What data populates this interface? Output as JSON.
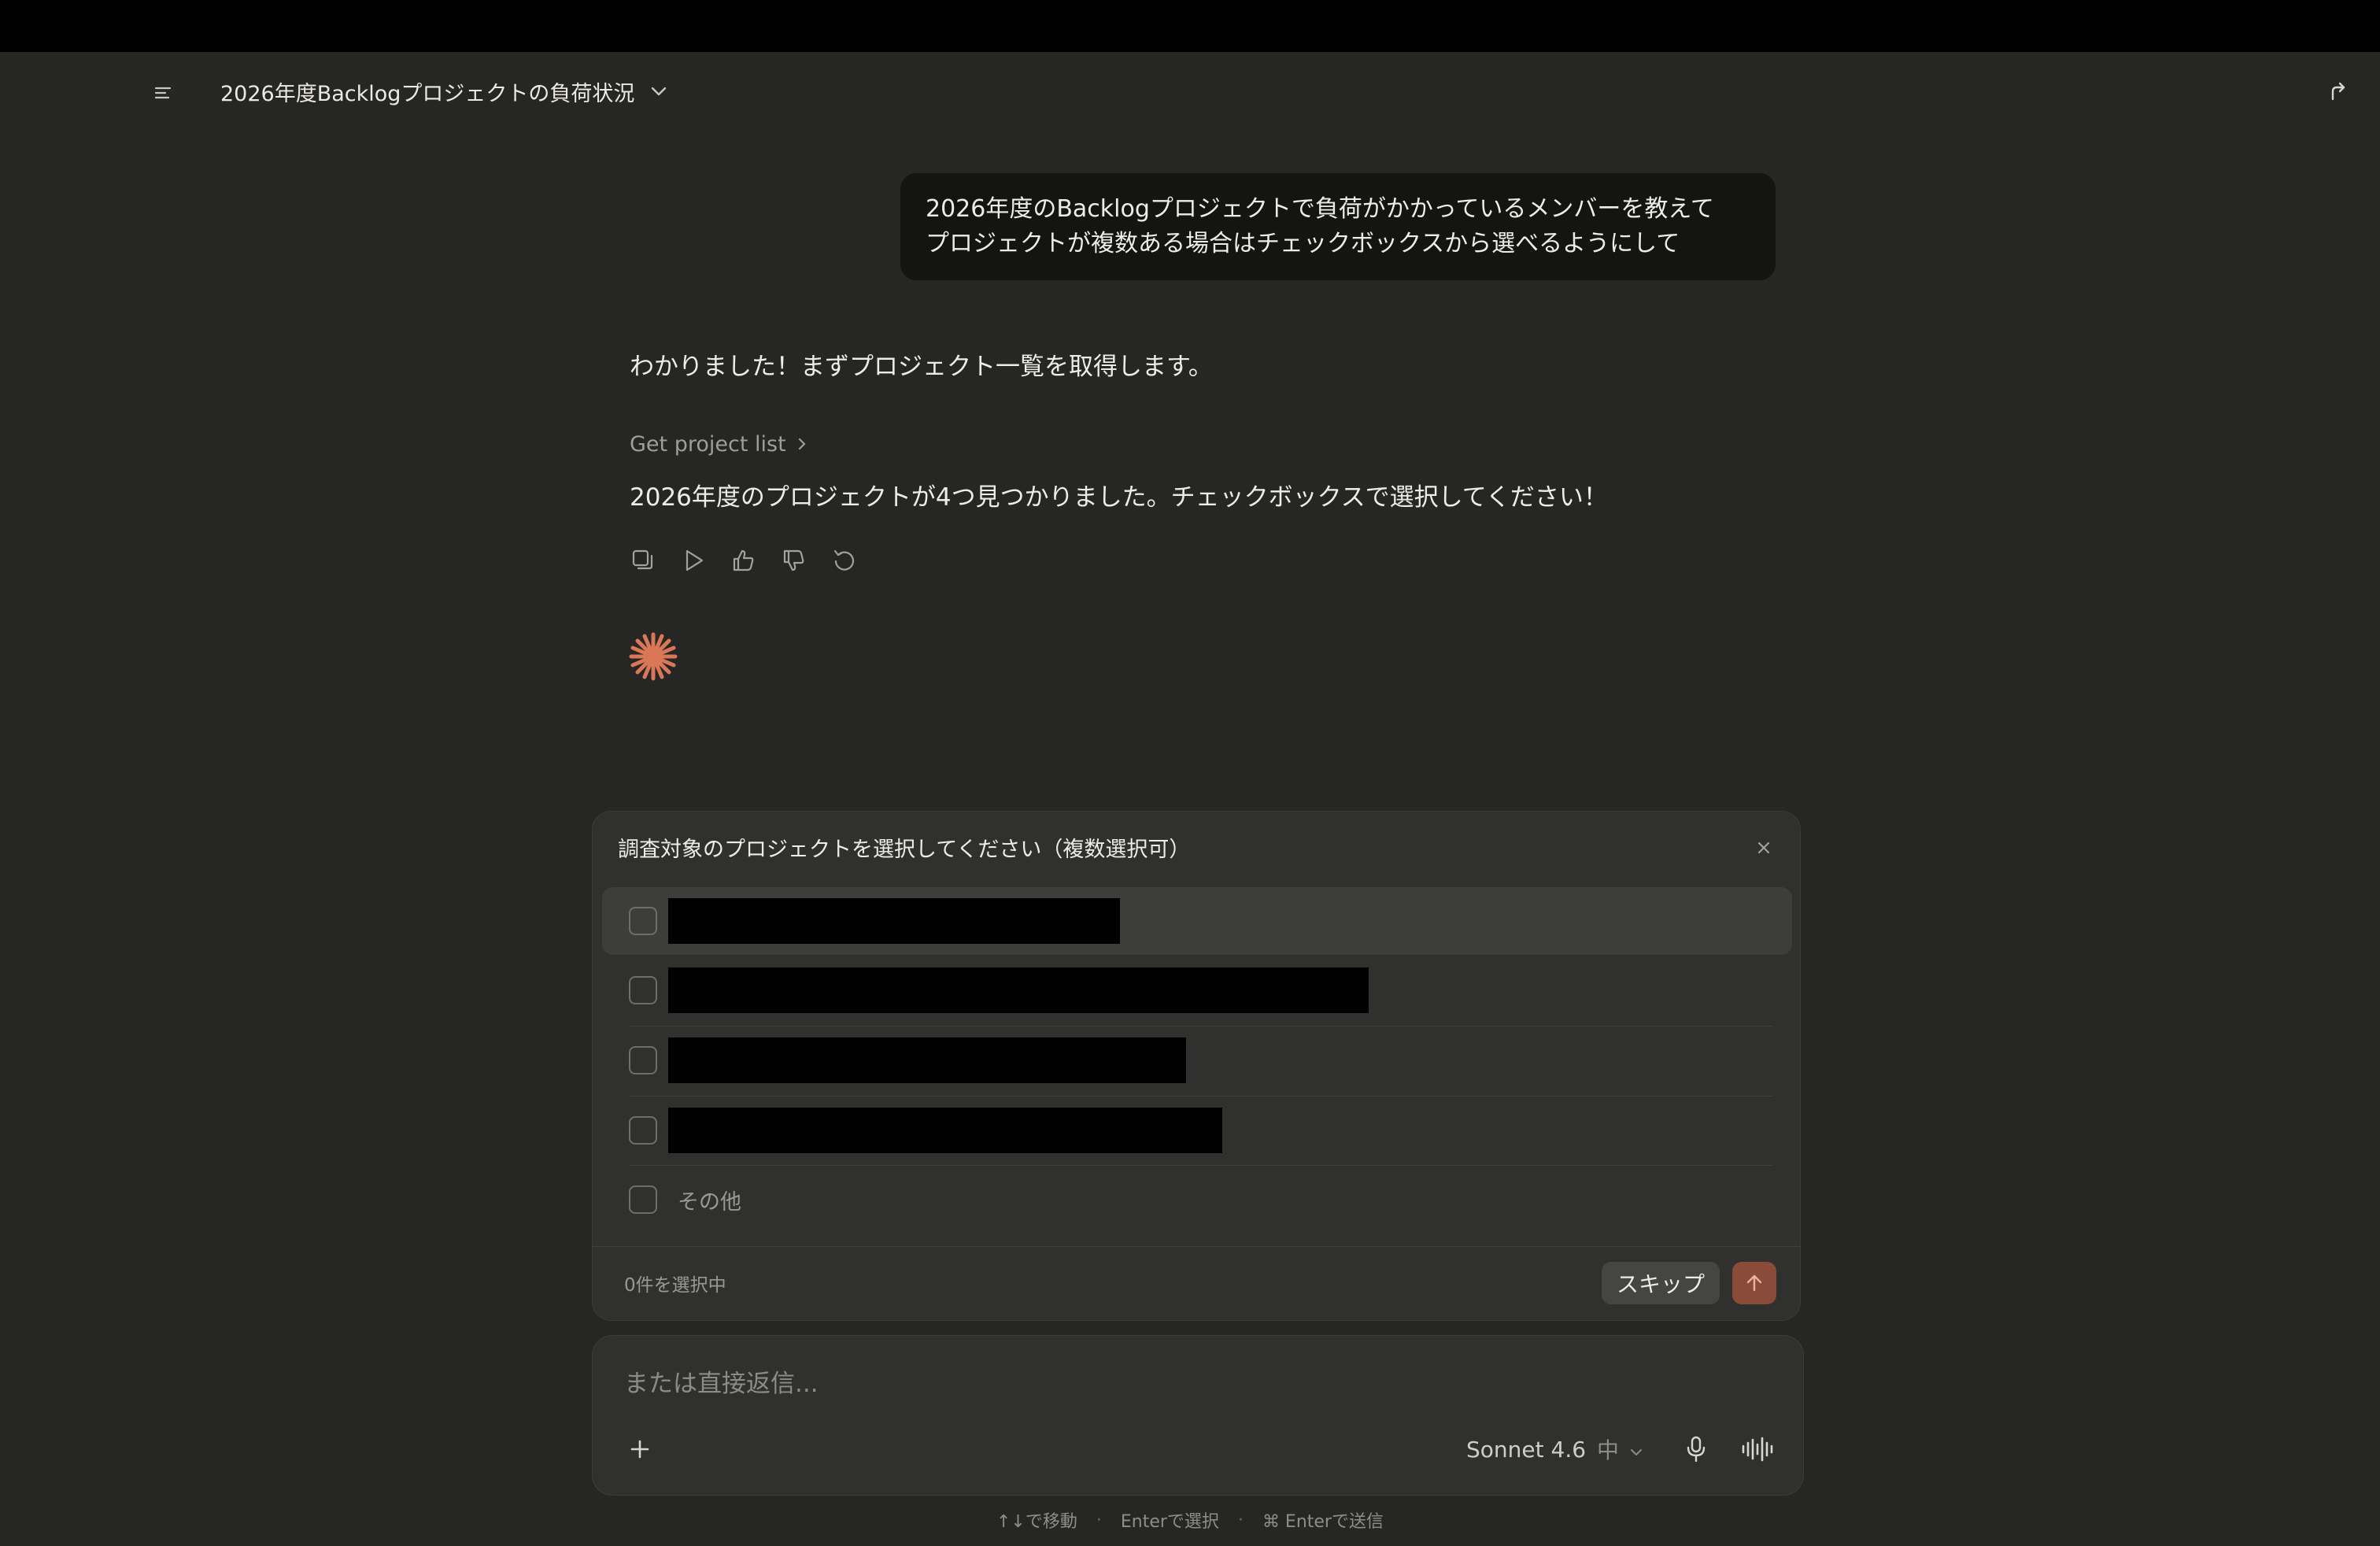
{
  "header": {
    "title": "2026年度Backlogプロジェクトの負荷状況"
  },
  "messages": {
    "user": {
      "line1": "2026年度のBacklogプロジェクトで負荷がかかっているメンバーを教えて",
      "line2": "プロジェクトが複数ある場合はチェックボックスから選べるようにして"
    },
    "assistant": {
      "intro": "わかりました！まずプロジェクト一覧を取得します。",
      "tool_call_label": "Get project list",
      "result": "2026年度のプロジェクトが4つ見つかりました。チェックボックスで選択してください！"
    }
  },
  "action_icons": [
    "copy-icon",
    "play-icon",
    "thumbs-up-icon",
    "thumbs-down-icon",
    "retry-icon"
  ],
  "question": {
    "title": "調査対象のプロジェクトを選択してください（複数選択可）",
    "options": [
      {
        "label": "",
        "redacted": true
      },
      {
        "label": "",
        "redacted": true
      },
      {
        "label": "",
        "redacted": true
      },
      {
        "label": "",
        "redacted": true
      },
      {
        "label": "その他",
        "redacted": false
      }
    ],
    "selected_count": "0件を選択中",
    "skip_label": "スキップ"
  },
  "composer": {
    "placeholder": "または直接返信...",
    "model": "Sonnet 4.6",
    "effort": "中"
  },
  "hints": {
    "move": "↑↓で移動",
    "select": "Enterで選択",
    "send": "⌘ Enterで送信",
    "separator": "·"
  },
  "colors": {
    "background": "#262624",
    "accent": "#d97757",
    "submit": "#8a4b39"
  }
}
